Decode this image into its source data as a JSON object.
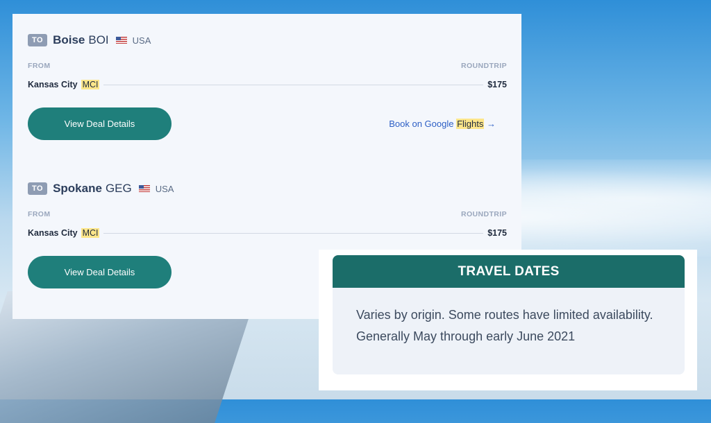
{
  "deals": [
    {
      "to_badge": "TO",
      "city": "Boise",
      "code": "BOI",
      "country": "USA",
      "from_label": "FROM",
      "trip_label": "ROUNDTRIP",
      "origin_city": "Kansas City",
      "origin_code": "MCI",
      "price": "$175",
      "button_label": "View Deal Details",
      "google_link_prefix": "Book on Google",
      "google_link_highlight": "Flights",
      "google_link_arrow": "→"
    },
    {
      "to_badge": "TO",
      "city": "Spokane",
      "code": "GEG",
      "country": "USA",
      "from_label": "FROM",
      "trip_label": "ROUNDTRIP",
      "origin_city": "Kansas City",
      "origin_code": "MCI",
      "price": "$175",
      "button_label": "View Deal Details"
    }
  ],
  "travel_dates": {
    "title": "TRAVEL DATES",
    "text": "Varies by origin. Some routes have limited availability. Generally May through early June 2021"
  },
  "colors": {
    "accent": "#1f7f7b",
    "header_teal": "#1b6d69",
    "highlight": "#fde68a",
    "link": "#2d5fc5"
  }
}
